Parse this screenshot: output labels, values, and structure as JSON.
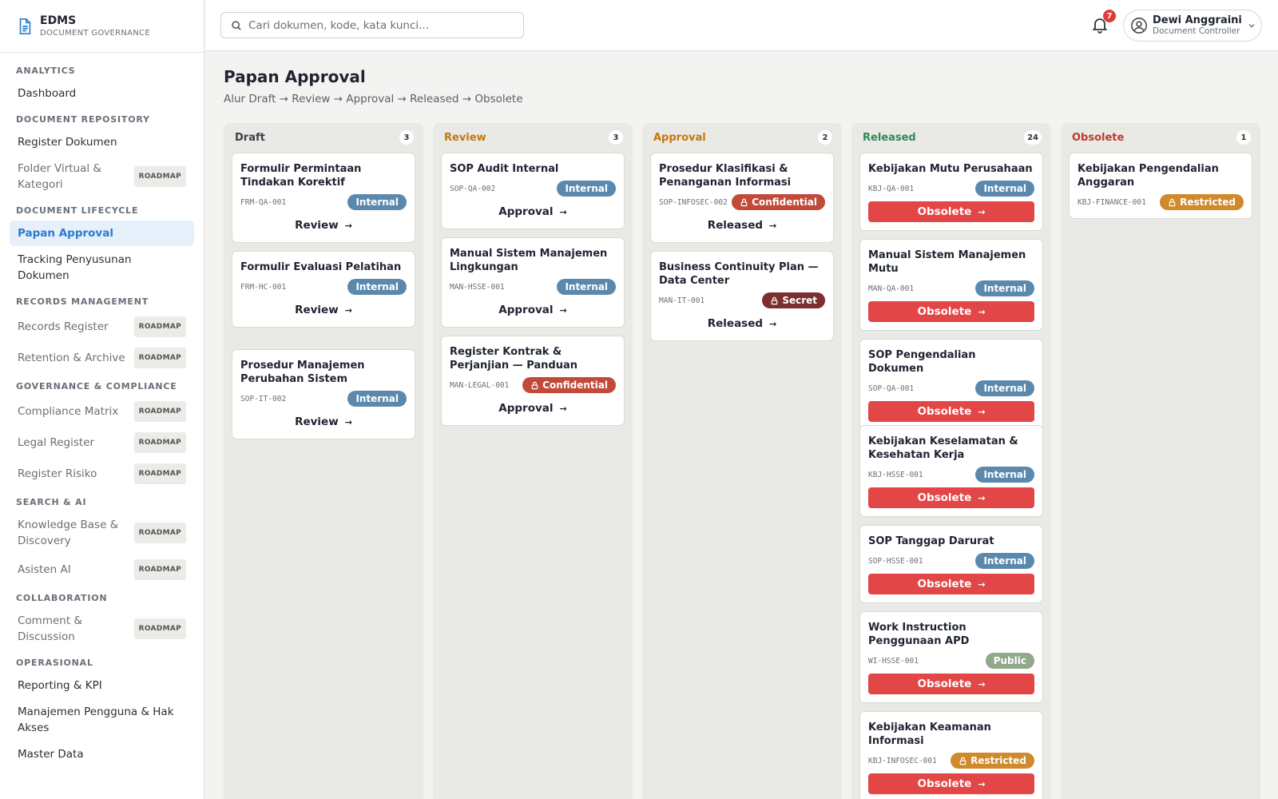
{
  "app": {
    "name": "EDMS",
    "subtitle": "DOCUMENT GOVERNANCE"
  },
  "search": {
    "placeholder": "Cari dokumen, kode, kata kunci..."
  },
  "notifications": {
    "count": "7"
  },
  "user": {
    "name": "Dewi Anggraini",
    "role": "Document Controller"
  },
  "colors": {
    "accent": "#2b7bd0",
    "internal": "#5b89ad",
    "confidential": "#c24a3b",
    "secret": "#7d2e2e",
    "restricted": "#d08a2c",
    "public": "#8fa98a",
    "obsolete_btn": "#e34646"
  },
  "sidebar": {
    "s_analytics": "ANALYTICS",
    "i_dashboard": "Dashboard",
    "s_repo": "DOCUMENT REPOSITORY",
    "i_register": "Register Dokumen",
    "i_folder": "Folder Virtual & Kategori",
    "s_lifecycle": "DOCUMENT LIFECYCLE",
    "i_papan": "Papan Approval",
    "i_tracking": "Tracking Penyusunan Dokumen",
    "s_records": "RECORDS MANAGEMENT",
    "i_records": "Records Register",
    "i_retention": "Retention & Archive",
    "s_gov": "GOVERNANCE & COMPLIANCE",
    "i_compliance": "Compliance Matrix",
    "i_legal": "Legal Register",
    "i_risiko": "Register Risiko",
    "s_search": "SEARCH & AI",
    "i_kb": "Knowledge Base & Discovery",
    "i_ai": "Asisten AI",
    "s_collab": "COLLABORATION",
    "i_comment": "Comment & Discussion",
    "s_ops": "OPERASIONAL",
    "i_reporting": "Reporting & KPI",
    "i_users": "Manajemen Pengguna & Hak Akses",
    "i_master": "Master Data",
    "roadmap": "ROADMAP"
  },
  "page": {
    "title": "Papan Approval",
    "subtitle": "Alur Draft → Review → Approval → Released → Obsolete"
  },
  "board": {
    "draft": {
      "title": "Draft",
      "count": "3",
      "cards": [
        {
          "title": "Formulir Permintaan Tindakan Korektif",
          "code": "FRM-QA-001",
          "cls": "Internal",
          "action": "Review"
        },
        {
          "title": "Formulir Evaluasi Pelatihan",
          "code": "FRM-HC-001",
          "cls": "Internal",
          "action": "Review"
        },
        {
          "title": "Prosedur Manajemen Perubahan Sistem",
          "code": "SOP-IT-002",
          "cls": "Internal",
          "action": "Review"
        }
      ]
    },
    "review": {
      "title": "Review",
      "count": "3",
      "cards": [
        {
          "title": "SOP Audit Internal",
          "code": "SOP-QA-002",
          "cls": "Internal",
          "action": "Approval"
        },
        {
          "title": "Manual Sistem Manajemen Lingkungan",
          "code": "MAN-HSSE-001",
          "cls": "Internal",
          "action": "Approval"
        },
        {
          "title": "Register Kontrak & Perjanjian — Panduan",
          "code": "MAN-LEGAL-001",
          "cls": "Confidential",
          "action": "Approval"
        }
      ]
    },
    "approval": {
      "title": "Approval",
      "count": "2",
      "cards": [
        {
          "title": "Prosedur Klasifikasi & Penanganan Informasi",
          "code": "SOP-INFOSEC-002",
          "cls": "Confidential",
          "action": "Released"
        },
        {
          "title": "Business Continuity Plan — Data Center",
          "code": "MAN-IT-001",
          "cls": "Secret",
          "action": "Released"
        }
      ]
    },
    "released": {
      "title": "Released",
      "count": "24",
      "cards": [
        {
          "title": "Kebijakan Mutu Perusahaan",
          "code": "KBJ-QA-001",
          "cls": "Internal",
          "action": "Obsolete"
        },
        {
          "title": "Manual Sistem Manajemen Mutu",
          "code": "MAN-QA-001",
          "cls": "Internal",
          "action": "Obsolete"
        },
        {
          "title": "SOP Pengendalian Dokumen",
          "code": "SOP-QA-001",
          "cls": "Internal",
          "action": "Obsolete"
        },
        {
          "title": "Kebijakan Keselamatan & Kesehatan Kerja",
          "code": "KBJ-HSSE-001",
          "cls": "Internal",
          "action": "Obsolete"
        },
        {
          "title": "SOP Tanggap Darurat",
          "code": "SOP-HSSE-001",
          "cls": "Internal",
          "action": "Obsolete"
        },
        {
          "title": "Work Instruction Penggunaan APD",
          "code": "WI-HSSE-001",
          "cls": "Public",
          "action": "Obsolete"
        },
        {
          "title": "Kebijakan Keamanan Informasi",
          "code": "KBJ-INFOSEC-001",
          "cls": "Restricted",
          "action": "Obsolete"
        }
      ]
    },
    "obsolete": {
      "title": "Obsolete",
      "count": "1",
      "cards": [
        {
          "title": "Kebijakan Pengendalian Anggaran",
          "code": "KBJ-FINANCE-001",
          "cls": "Restricted"
        }
      ]
    }
  }
}
